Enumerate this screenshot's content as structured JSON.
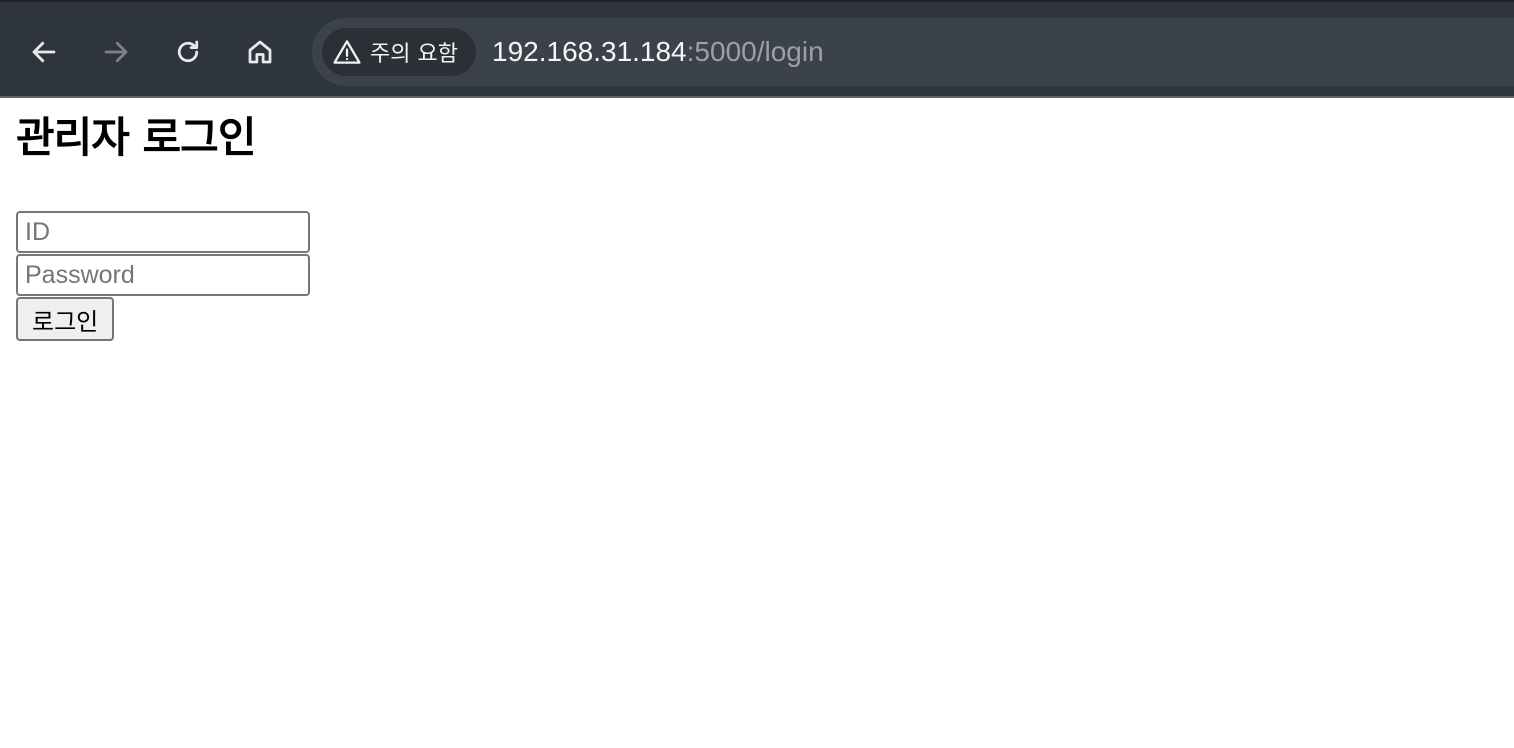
{
  "browser": {
    "security_label": "주의 요함",
    "url_host": "192.168.31.184",
    "url_path": ":5000/login",
    "icons": {
      "back": "back-arrow-icon",
      "forward": "forward-arrow-icon",
      "reload": "reload-icon",
      "home": "home-icon",
      "warning": "warning-icon"
    }
  },
  "page": {
    "title": "관리자 로그인",
    "form": {
      "id_placeholder": "ID",
      "id_value": "",
      "password_placeholder": "Password",
      "password_value": "",
      "submit_label": "로그인"
    }
  },
  "colors": {
    "toolbar_bg": "#2f353c",
    "omnibox_bg": "#3c4249",
    "chip_bg": "#2b3036",
    "url_host": "#f4f6f8",
    "url_path": "#9aa0a6"
  }
}
